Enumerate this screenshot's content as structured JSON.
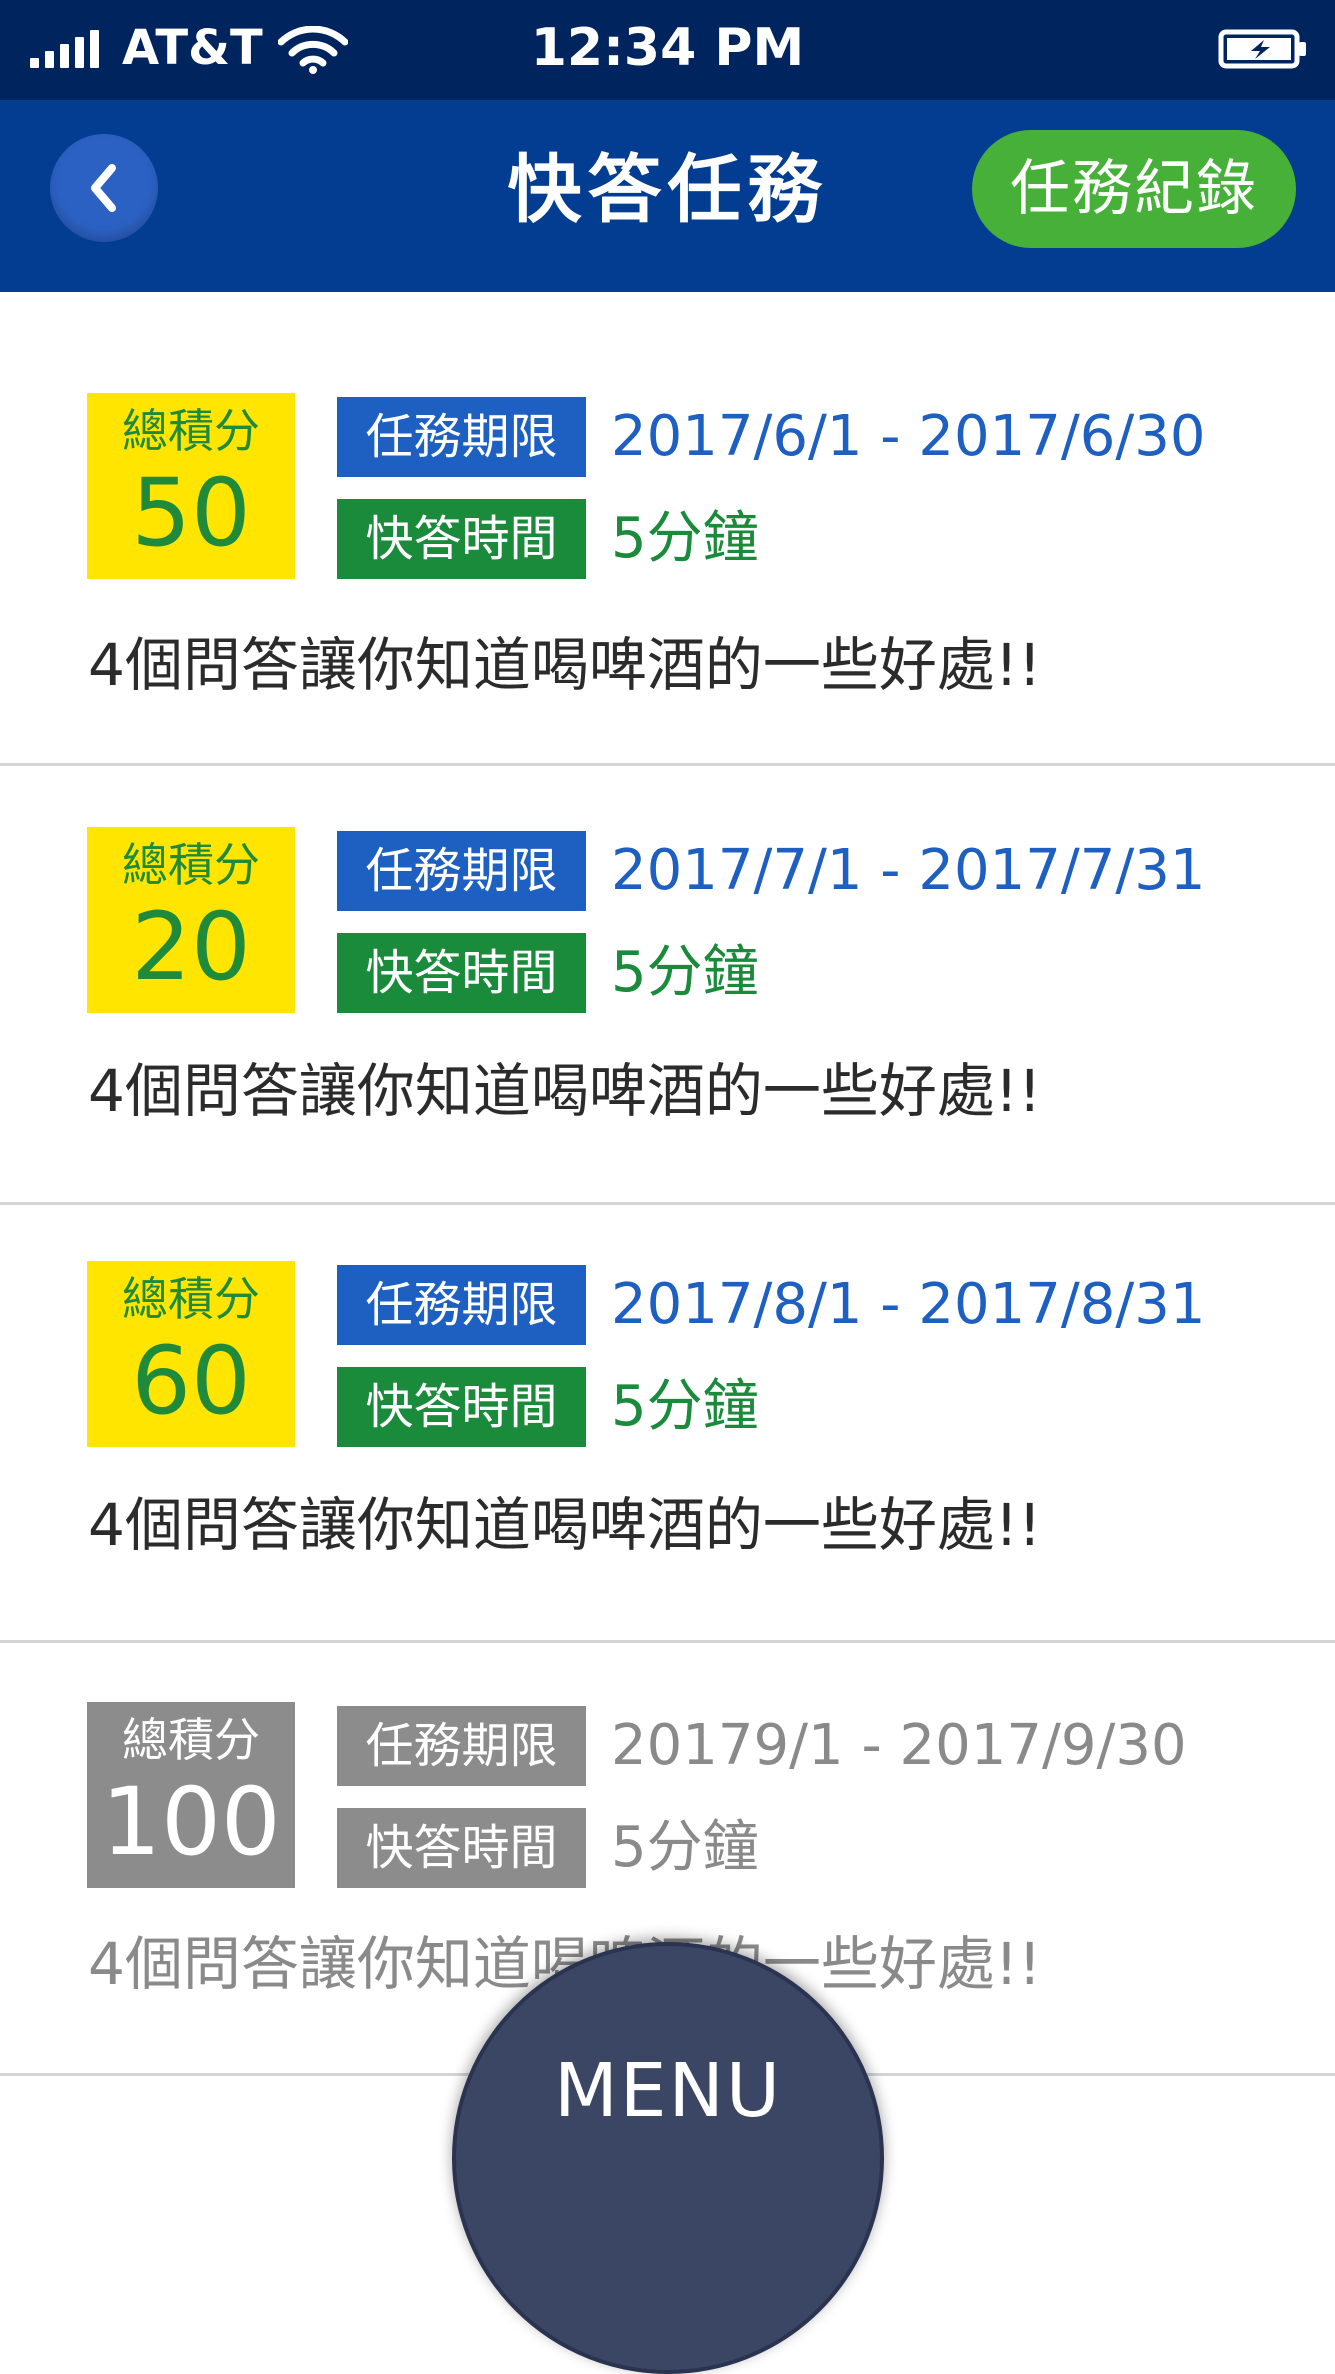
{
  "status_bar": {
    "carrier": "AT&T",
    "time": "12:34 PM",
    "signal_icon": "signal-bars-icon",
    "wifi_icon": "wifi-icon",
    "battery_icon": "battery-charging-icon"
  },
  "nav": {
    "back_icon": "chevron-left-icon",
    "title": "快答任務",
    "record_button": "任務紀錄"
  },
  "tasks": [
    {
      "score_label": "總積分",
      "score": "50",
      "period_label": "任務期限",
      "period": "2017/6/1 - 2017/6/30",
      "time_label": "快答時間",
      "time": "5分鐘",
      "description": "4個問答讓你知道喝啤酒的一些好處!!",
      "status": "active"
    },
    {
      "score_label": "總積分",
      "score": "20",
      "period_label": "任務期限",
      "period": "2017/7/1 - 2017/7/31",
      "time_label": "快答時間",
      "time": "5分鐘",
      "description": "4個問答讓你知道喝啤酒的一些好處!!",
      "status": "active"
    },
    {
      "score_label": "總積分",
      "score": "60",
      "period_label": "任務期限",
      "period": "2017/8/1 - 2017/8/31",
      "time_label": "快答時間",
      "time": "5分鐘",
      "description": "4個問答讓你知道喝啤酒的一些好處!!",
      "status": "active"
    },
    {
      "score_label": "總積分",
      "score": "100",
      "period_label": "任務期限",
      "period": "20179/1 - 2017/9/30",
      "time_label": "快答時間",
      "time": "5分鐘",
      "description": "4個問答讓你知道喝啤酒的一些好處!!",
      "status": "inactive"
    }
  ],
  "menu": {
    "label": "MENU"
  },
  "colors": {
    "status_bar": "#00255e",
    "nav_bar": "#033d91",
    "record_button": "#47b039",
    "score_box_active": "#ffe500",
    "score_box_inactive": "#8c8c8c",
    "period_tag": "#1e5fc2",
    "time_tag": "#1a8a3b",
    "menu_button": "#3b4664"
  }
}
